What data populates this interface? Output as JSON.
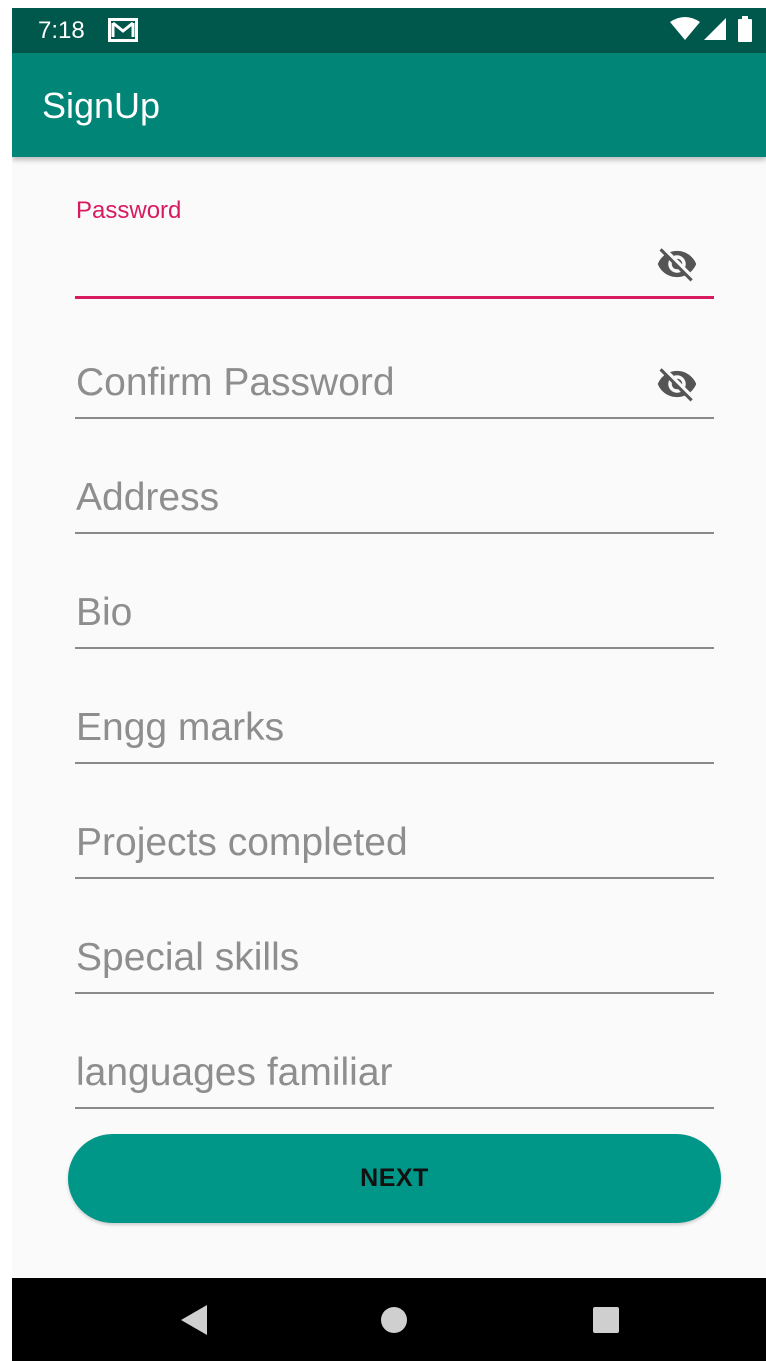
{
  "status_bar": {
    "time": "7:18",
    "icons": [
      "gmail-icon",
      "wifi-icon",
      "signal-icon",
      "battery-icon"
    ]
  },
  "app_bar": {
    "title": "SignUp"
  },
  "form": {
    "fields": [
      {
        "id": "password",
        "label": "Password",
        "value": "",
        "focused": true,
        "has_visibility_toggle": true,
        "toggle_icon": "visibility-off-icon"
      },
      {
        "id": "confirm_password",
        "placeholder": "Confirm Password",
        "value": "",
        "has_visibility_toggle": true,
        "toggle_icon": "visibility-off-icon"
      },
      {
        "id": "address",
        "placeholder": "Address",
        "value": ""
      },
      {
        "id": "bio",
        "placeholder": "Bio",
        "value": ""
      },
      {
        "id": "engg_marks",
        "placeholder": "Engg marks",
        "value": ""
      },
      {
        "id": "projects_completed",
        "placeholder": "Projects completed",
        "value": ""
      },
      {
        "id": "special_skills",
        "placeholder": "Special skills",
        "value": ""
      },
      {
        "id": "languages_familiar",
        "placeholder": "languages familiar",
        "value": ""
      }
    ],
    "next_button_label": "NEXT"
  },
  "nav_bar": {
    "buttons": [
      "back-icon",
      "home-icon",
      "recents-icon"
    ]
  },
  "colors": {
    "status_bar": "#00574b",
    "app_bar": "#008577",
    "accent": "#d81b60",
    "button": "#009688",
    "hint_text": "#8e8e8e",
    "background": "#fafafa"
  }
}
